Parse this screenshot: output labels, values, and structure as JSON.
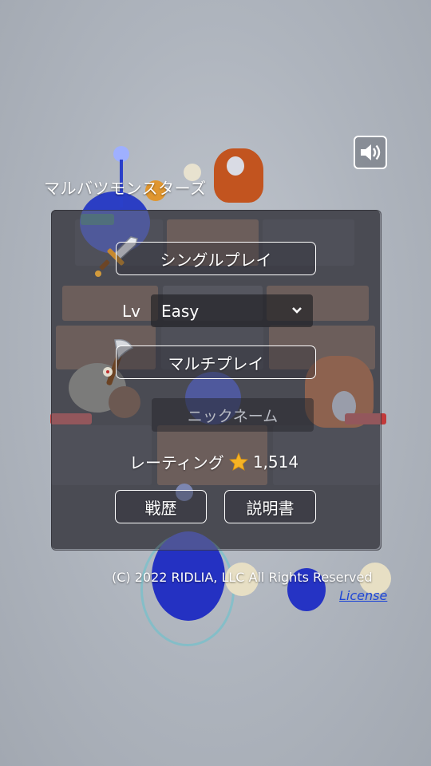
{
  "app": {
    "title": "マルバツモンスターズ"
  },
  "menu": {
    "single_play_label": "シングルプレイ",
    "level_label": "Lv",
    "level_selected": "Easy",
    "multi_play_label": "マルチプレイ",
    "nickname_placeholder": "ニックネーム",
    "rating_label": "レーティング",
    "rating_value": "1,514",
    "history_label": "戦歴",
    "manual_label": "説明書"
  },
  "footer": {
    "copyright": "(C) 2022 RIDLIA, LLC All Rights Reserved",
    "license_link": "License"
  },
  "icons": {
    "sound": "speaker-icon",
    "sword": "sword-icon",
    "axe": "axe-icon",
    "star": "star-icon",
    "dropdown": "chevron-down-icon"
  },
  "colors": {
    "star": "#f5b324",
    "license_link": "#1e46d6",
    "blue_team": "#2a3fc9",
    "orange_team": "#c2541f",
    "hp_red": "#c23a3a",
    "hp_teal": "#2d6f80"
  }
}
